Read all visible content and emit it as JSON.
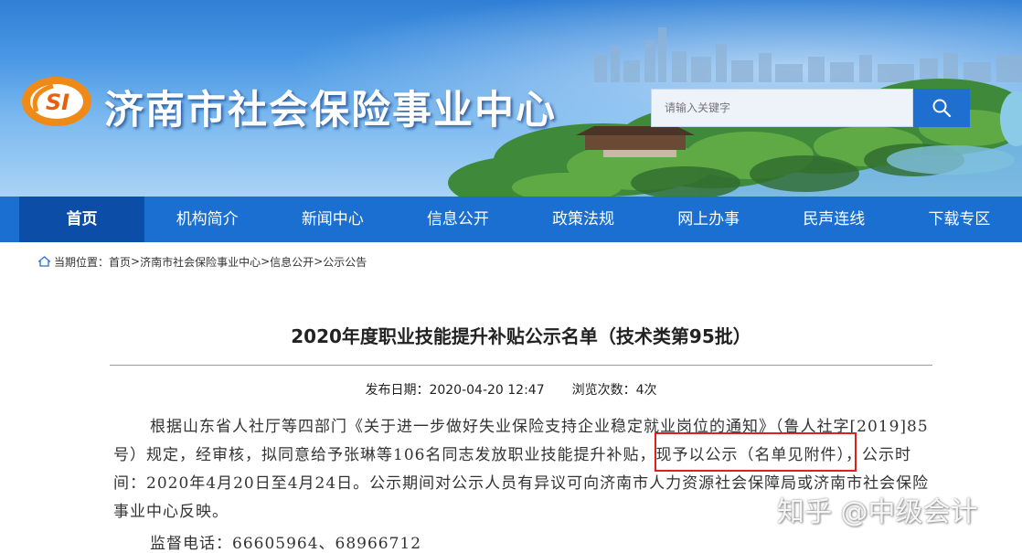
{
  "site": {
    "title": "济南市社会保险事业中心",
    "logo_text": "SI"
  },
  "search": {
    "placeholder": "请输入关键字",
    "button_icon": "search-icon"
  },
  "nav": {
    "items": [
      {
        "label": "首页",
        "active": true
      },
      {
        "label": "机构简介"
      },
      {
        "label": "新闻中心"
      },
      {
        "label": "信息公开"
      },
      {
        "label": "政策法规"
      },
      {
        "label": "网上办事"
      },
      {
        "label": "民声连线"
      },
      {
        "label": "下载专区"
      }
    ]
  },
  "breadcrumb": {
    "prefix": "当期位置：",
    "items": [
      "首页",
      "济南市社会保险事业中心",
      "信息公开",
      "公示公告"
    ],
    "separator": ">"
  },
  "article": {
    "title": "2020年度职业技能提升补贴公示名单（技术类第95批）",
    "publish_label": "发布日期：",
    "publish_date": "2020-04-20 12:47",
    "views_label": "浏览次数：",
    "views": "4次",
    "body_part1": "根据山东省人社厅等四部门《关于进一步做好失业保险支持企业稳定就业岗位的通知》（鲁人社字[2019]85号）规定，经审核，拟同意给予张琳等106名同志",
    "body_highlight": "发放职业技能提升补贴",
    "body_part2": "，现予以公示（名单见附件），公示时间：2020年4月20日至4月24日。公示期间对公示人员有异议可向济南市人力资源社会保障局或济南市社会保险事业中心反映。",
    "phone_label": "监督电话：",
    "phone_numbers": "66605964、68966712"
  },
  "watermark": "知乎 @中级会计",
  "colors": {
    "nav_bg": "#1b6fd0",
    "nav_active": "#0c4da8",
    "highlight_box": "#e0201c"
  }
}
